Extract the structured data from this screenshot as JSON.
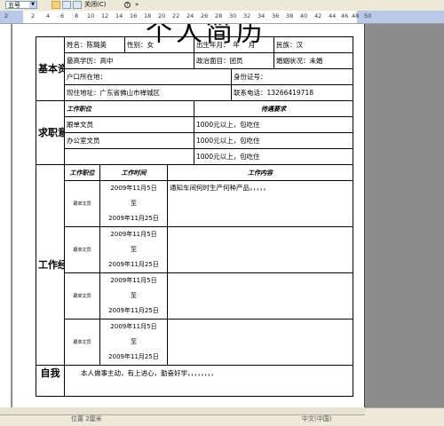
{
  "toolbar": {
    "font_size": "五号",
    "close_label": "关闭(C)",
    "help_glyph": "?",
    "ruler_numbers": [
      "2",
      "4",
      "6",
      "8",
      "10",
      "12",
      "14",
      "16",
      "18",
      "20",
      "22",
      "24",
      "26",
      "28",
      "30",
      "32",
      "34",
      "36",
      "38",
      "40",
      "42",
      "44",
      "46",
      "48",
      "50"
    ],
    "ruler_left_number": "2"
  },
  "document": {
    "title": "个人简历",
    "basic": {
      "section": "基本资料",
      "name": "姓名：陈璐英",
      "gender": "性别：女",
      "birth": "出生年月：　年　 月",
      "ethnicity": "民族：汉",
      "education": "最高学历：高中",
      "political": "政治面目：团员",
      "marital": "婚姻状况：未婚",
      "hukou": "户口所在地：",
      "id_number": "身份证号：",
      "address": "现住地址：广东省佛山市禅城区",
      "phone": "联系电话：13266419718"
    },
    "job_intent": {
      "section": "求职意向",
      "col_position": "工作职位",
      "col_requirement": "待遇要求",
      "rows": [
        {
          "position": "跟单文员",
          "requirement": "1000元以上，包吃住"
        },
        {
          "position": "办公室文员",
          "requirement": "1000元以上，包吃住"
        },
        {
          "position": "",
          "requirement": "1000元以上，包吃住"
        }
      ]
    },
    "experience": {
      "section": "工作经历",
      "col_position": "工作职位",
      "col_period": "工作时间",
      "col_content": "工作内容",
      "rows": [
        {
          "position": "跟单文员",
          "start": "2009年11月5日",
          "to": "至",
          "end": "2009年11月25日",
          "content": "通知车间何时生产何种产品，，，，，"
        },
        {
          "position": "跟单文员",
          "start": "2009年11月5日",
          "to": "至",
          "end": "2009年11月25日",
          "content": ""
        },
        {
          "position": "跟单文员",
          "start": "2009年11月5日",
          "to": "至",
          "end": "2009年11月25日",
          "content": ""
        },
        {
          "position": "跟单文员",
          "start": "2009年11月5日",
          "to": "至",
          "end": "2009年11月25日",
          "content": ""
        }
      ]
    },
    "self": {
      "section": "自我",
      "text": "本人做事主动，有上进心，勤奋好学，，，，，，，，"
    }
  },
  "statusbar": {
    "page_info": "位置 2厘米",
    "mode": "中文(中国)"
  }
}
